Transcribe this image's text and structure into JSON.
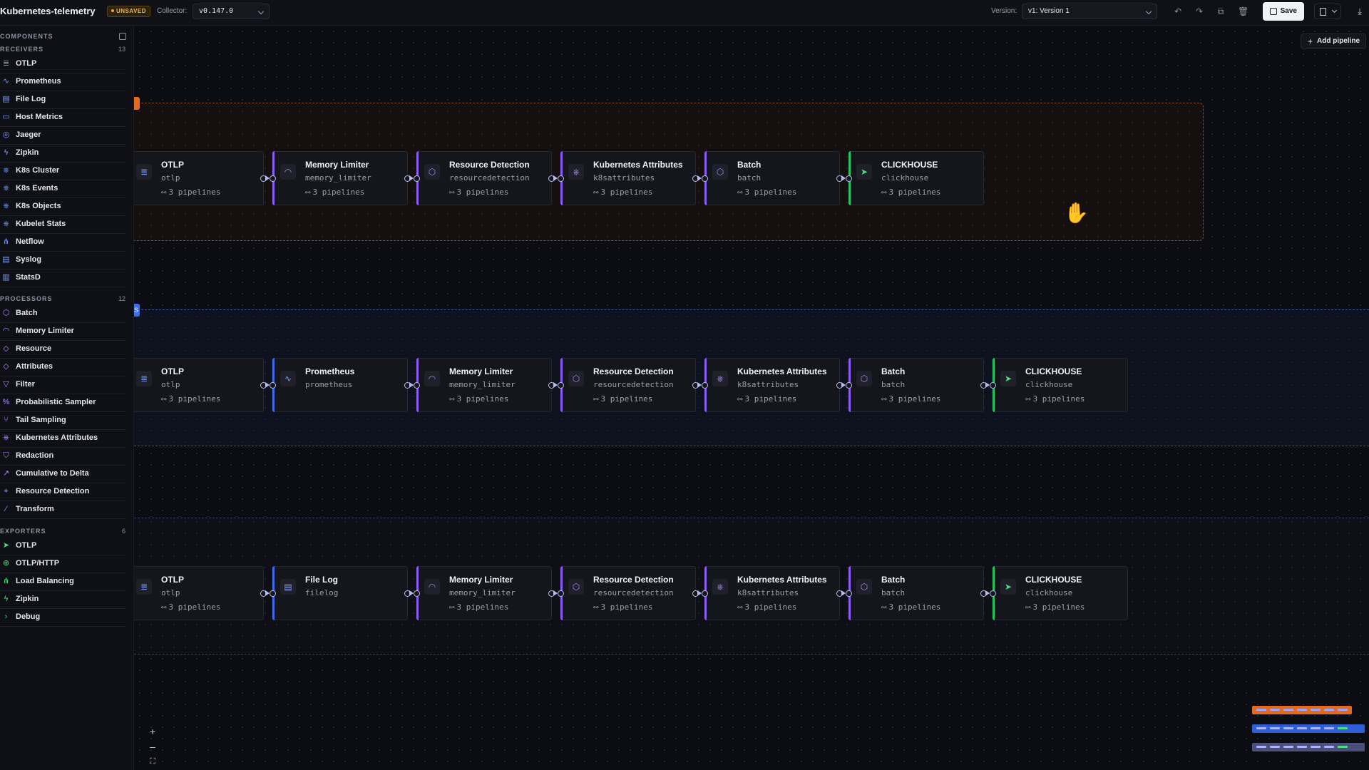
{
  "header": {
    "app_title": "Kubernetes-telemetry",
    "unsaved_badge": "UNSAVED",
    "collector_label": "Collector:",
    "collector_value": "v0.147.0",
    "version_label": "Version:",
    "version_value": "v1: Version 1",
    "save_label": "Save"
  },
  "sidebar": {
    "title": "COMPONENTS",
    "receivers": {
      "header": "RECEIVERS",
      "count": "13",
      "items": [
        {
          "label": "OTLP",
          "icon": "database-icon"
        },
        {
          "label": "Prometheus",
          "icon": "activity-icon"
        },
        {
          "label": "File Log",
          "icon": "file-icon"
        },
        {
          "label": "Host Metrics",
          "icon": "server-icon"
        },
        {
          "label": "Jaeger",
          "icon": "compass-icon"
        },
        {
          "label": "Zipkin",
          "icon": "zap-icon"
        },
        {
          "label": "K8s Cluster",
          "icon": "k8s-icon"
        },
        {
          "label": "K8s Events",
          "icon": "k8s-icon"
        },
        {
          "label": "K8s Objects",
          "icon": "k8s-icon"
        },
        {
          "label": "Kubelet Stats",
          "icon": "k8s-icon"
        },
        {
          "label": "Netflow",
          "icon": "network-icon"
        },
        {
          "label": "Syslog",
          "icon": "document-icon"
        },
        {
          "label": "StatsD",
          "icon": "bar-chart-icon"
        }
      ]
    },
    "processors": {
      "header": "PROCESSORS",
      "count": "12",
      "items": [
        {
          "label": "Batch",
          "icon": "package-icon"
        },
        {
          "label": "Memory Limiter",
          "icon": "gauge-icon"
        },
        {
          "label": "Resource",
          "icon": "tag-icon"
        },
        {
          "label": "Attributes",
          "icon": "tag-icon"
        },
        {
          "label": "Filter",
          "icon": "filter-icon"
        },
        {
          "label": "Probabilistic Sampler",
          "icon": "percent-icon"
        },
        {
          "label": "Tail Sampling",
          "icon": "git-branch-icon"
        },
        {
          "label": "Kubernetes Attributes",
          "icon": "k8s-icon"
        },
        {
          "label": "Redaction",
          "icon": "shield-icon"
        },
        {
          "label": "Cumulative to Delta",
          "icon": "trending-icon"
        },
        {
          "label": "Resource Detection",
          "icon": "scan-icon"
        },
        {
          "label": "Transform",
          "icon": "wand-icon"
        }
      ]
    },
    "exporters": {
      "header": "EXPORTERS",
      "count": "6",
      "items": [
        {
          "label": "OTLP",
          "icon": "send-icon"
        },
        {
          "label": "OTLP/HTTP",
          "icon": "globe-icon"
        },
        {
          "label": "Load Balancing",
          "icon": "network-icon"
        },
        {
          "label": "Zipkin",
          "icon": "zap-icon"
        },
        {
          "label": "Debug",
          "icon": "terminal-icon"
        }
      ]
    }
  },
  "canvas": {
    "add_pipeline_label": "Add pipeline",
    "pipeline_tags": [
      "",
      "S"
    ],
    "pipelines": [
      {
        "accent": "#e46b1e",
        "nodes": [
          {
            "title": "OTLP",
            "id": "otlp",
            "pipelines": "3 pipelines",
            "kind": "receiver",
            "icon": "database-icon"
          },
          {
            "title": "Memory Limiter",
            "id": "memory_limiter",
            "pipelines": "3 pipelines",
            "kind": "processor",
            "icon": "gauge-icon"
          },
          {
            "title": "Resource Detection",
            "id": "resourcedetection",
            "pipelines": "3 pipelines",
            "kind": "processor",
            "icon": "cube-icon"
          },
          {
            "title": "Kubernetes Attributes",
            "id": "k8sattributes",
            "pipelines": "3 pipelines",
            "kind": "processor",
            "icon": "k8s-icon"
          },
          {
            "title": "Batch",
            "id": "batch",
            "pipelines": "3 pipelines",
            "kind": "processor",
            "icon": "cube-icon"
          },
          {
            "title": "CLICKHOUSE",
            "id": "clickhouse",
            "pipelines": "3 pipelines",
            "kind": "exporter",
            "icon": "send-icon"
          }
        ]
      },
      {
        "accent": "#3b6df0",
        "nodes": [
          {
            "title": "OTLP",
            "id": "otlp",
            "pipelines": "3 pipelines",
            "kind": "receiver",
            "icon": "database-icon"
          },
          {
            "title": "Prometheus",
            "id": "prometheus",
            "pipelines": "",
            "kind": "receiver",
            "icon": "activity-icon"
          },
          {
            "title": "Memory Limiter",
            "id": "memory_limiter",
            "pipelines": "3 pipelines",
            "kind": "processor",
            "icon": "gauge-icon"
          },
          {
            "title": "Resource Detection",
            "id": "resourcedetection",
            "pipelines": "3 pipelines",
            "kind": "processor",
            "icon": "cube-icon"
          },
          {
            "title": "Kubernetes Attributes",
            "id": "k8sattributes",
            "pipelines": "3 pipelines",
            "kind": "processor",
            "icon": "k8s-icon"
          },
          {
            "title": "Batch",
            "id": "batch",
            "pipelines": "3 pipelines",
            "kind": "processor",
            "icon": "cube-icon"
          },
          {
            "title": "CLICKHOUSE",
            "id": "clickhouse",
            "pipelines": "3 pipelines",
            "kind": "exporter",
            "icon": "send-icon"
          }
        ]
      },
      {
        "accent": "#6f6fd8",
        "nodes": [
          {
            "title": "OTLP",
            "id": "otlp",
            "pipelines": "3 pipelines",
            "kind": "receiver",
            "icon": "database-icon"
          },
          {
            "title": "File Log",
            "id": "filelog",
            "pipelines": "",
            "kind": "receiver",
            "icon": "file-icon"
          },
          {
            "title": "Memory Limiter",
            "id": "memory_limiter",
            "pipelines": "3 pipelines",
            "kind": "processor",
            "icon": "gauge-icon"
          },
          {
            "title": "Resource Detection",
            "id": "resourcedetection",
            "pipelines": "3 pipelines",
            "kind": "processor",
            "icon": "cube-icon"
          },
          {
            "title": "Kubernetes Attributes",
            "id": "k8sattributes",
            "pipelines": "3 pipelines",
            "kind": "processor",
            "icon": "k8s-icon"
          },
          {
            "title": "Batch",
            "id": "batch",
            "pipelines": "3 pipelines",
            "kind": "processor",
            "icon": "cube-icon"
          },
          {
            "title": "CLICKHOUSE",
            "id": "clickhouse",
            "pipelines": "3 pipelines",
            "kind": "exporter",
            "icon": "send-icon"
          }
        ]
      }
    ]
  },
  "colors": {
    "receiver": "#3b6df0",
    "processor": "#8b5cf6",
    "exporter": "#22c55e",
    "accent_orange": "#e46b1e"
  }
}
